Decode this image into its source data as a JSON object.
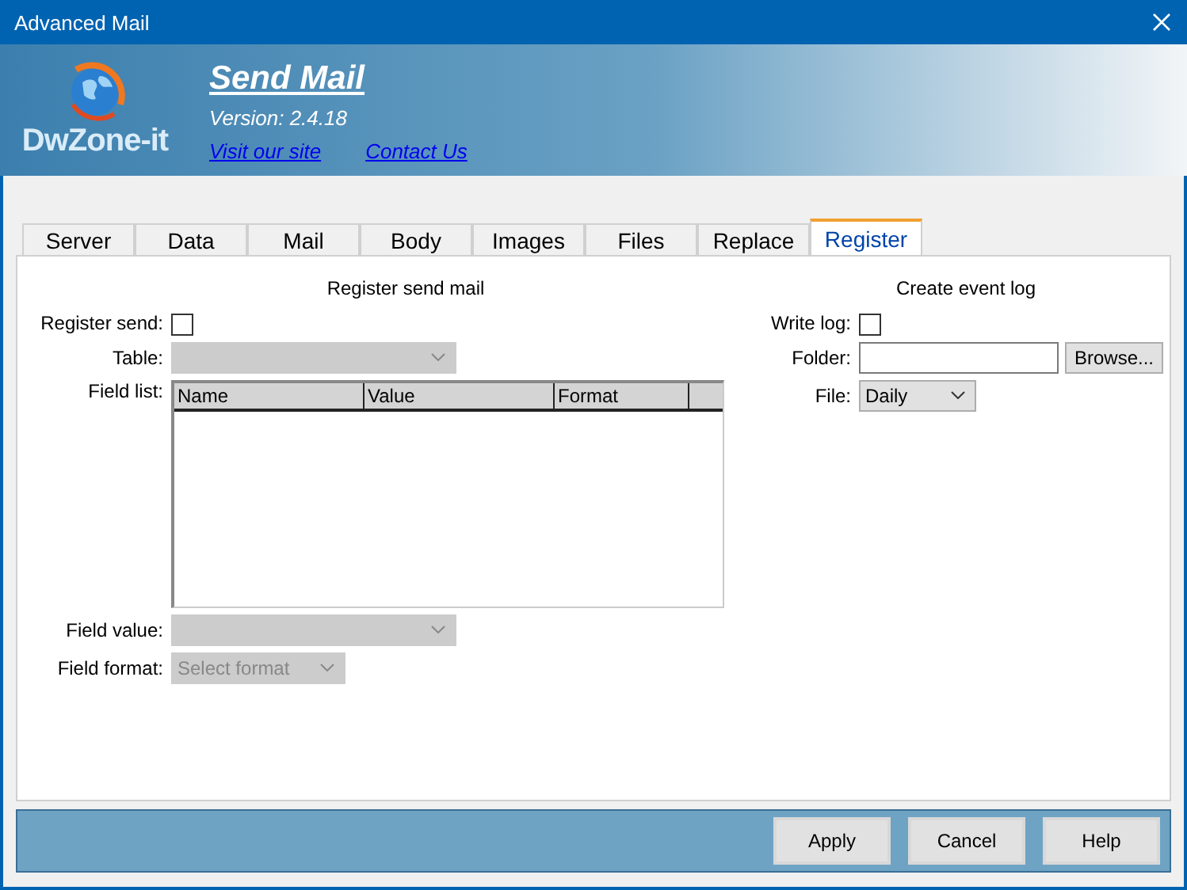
{
  "window": {
    "title": "Advanced Mail"
  },
  "header": {
    "logo_text": "DwZone-it",
    "title": "Send Mail",
    "version": "Version: 2.4.18",
    "links": [
      "Visit our site",
      "Contact Us"
    ]
  },
  "tabs": [
    {
      "label": "Server",
      "selected": false
    },
    {
      "label": "Data",
      "selected": false
    },
    {
      "label": "Mail",
      "selected": false
    },
    {
      "label": "Body",
      "selected": false
    },
    {
      "label": "Images",
      "selected": false
    },
    {
      "label": "Files",
      "selected": false
    },
    {
      "label": "Replace",
      "selected": false
    },
    {
      "label": "Register",
      "selected": true
    }
  ],
  "register": {
    "heading": "Register send mail",
    "register_send": {
      "label": "Register send:",
      "checked": false
    },
    "table": {
      "label": "Table:",
      "disabled": true
    },
    "field_list": {
      "label": "Field list:",
      "columns": [
        "Name",
        "Value",
        "Format"
      ]
    },
    "field_value": {
      "label": "Field value:",
      "disabled": true
    },
    "field_format": {
      "label": "Field format:",
      "placeholder": "Select format",
      "disabled": true
    }
  },
  "event_log": {
    "heading": "Create event log",
    "write_log": {
      "label": "Write log:",
      "checked": false
    },
    "folder": {
      "label": "Folder:"
    },
    "browse": "Browse...",
    "file": {
      "label": "File:",
      "value": "Daily",
      "disabled": false
    }
  },
  "buttons": [
    "Apply",
    "Cancel",
    "Help"
  ]
}
